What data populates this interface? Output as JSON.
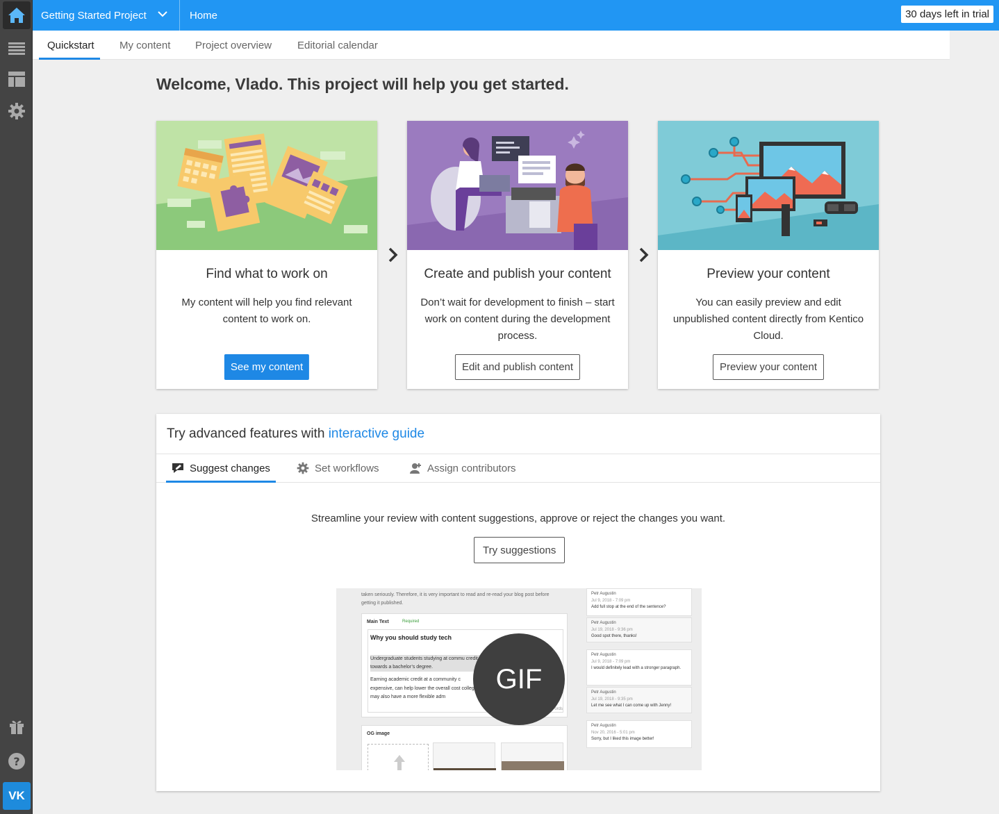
{
  "rail": {
    "items": [
      {
        "name": "home-icon"
      },
      {
        "name": "content-list-icon"
      },
      {
        "name": "layout-icon"
      },
      {
        "name": "settings-icon"
      }
    ],
    "bottom": [
      {
        "name": "gift-icon"
      },
      {
        "name": "help-icon"
      }
    ],
    "avatar_initials": "VK"
  },
  "topbar": {
    "project_name": "Getting Started Project",
    "breadcrumb": "Home",
    "trial_text": "30 days left in trial"
  },
  "tabs": [
    {
      "label": "Quickstart",
      "active": true
    },
    {
      "label": "My content",
      "active": false
    },
    {
      "label": "Project overview",
      "active": false
    },
    {
      "label": "Editorial calendar",
      "active": false
    }
  ],
  "welcome": "Welcome, Vlado. This project will help you get started.",
  "cards": [
    {
      "title": "Find what to work on",
      "description": "My content will help you find relevant content to work on.",
      "button": "See my content",
      "button_style": "primary"
    },
    {
      "title": "Create and publish your content",
      "description": "Don’t wait for development to finish – start work on content during the development process.",
      "button": "Edit and publish content",
      "button_style": "outline"
    },
    {
      "title": "Preview your content",
      "description": "You can easily preview and edit unpublished content directly from Kentico Cloud.",
      "button": "Preview your content",
      "button_style": "outline"
    }
  ],
  "guide": {
    "heading_prefix": "Try advanced features with",
    "heading_link": "interactive guide",
    "tabs": [
      {
        "label": "Suggest changes",
        "icon": "comment-edit-icon",
        "active": true
      },
      {
        "label": "Set workflows",
        "icon": "gear-icon",
        "active": false
      },
      {
        "label": "Assign contributors",
        "icon": "user-add-icon",
        "active": false
      }
    ],
    "description": "Streamline your review with content suggestions, approve or reject the changes you want.",
    "button": "Try suggestions",
    "gif_label": "GIF",
    "preview": {
      "intro": "taken seriously. Therefore, it is very important to read and re-read your blog post before getting it published.",
      "field_label": "Main Text",
      "required": "Required",
      "heading": "Why you should study tech",
      "para1": "Undergraduate students studying at commu credit towards a bachelor’s degree.",
      "para2": "Earning academic credit at a community c expensive, can help lower the overall cost colleges may also have a more flexible adm",
      "words": "ords",
      "og_label": "OG image",
      "comments": [
        {
          "author": "Petr Augustin",
          "date": "Jul 9, 2018 - 7:09 pm",
          "text": "Add full stop at the end of the sentence?"
        },
        {
          "author": "Petr Augustin",
          "date": "Jul 19, 2018 - 9:36 pm",
          "text": "Good spot there, thanks!"
        },
        {
          "author": "Petr Augustin",
          "date": "Jul 9, 2018 - 7:09 pm",
          "text": "I would definitely lead with a stronger paragraph."
        },
        {
          "author": "Petr Augustin",
          "date": "Jul 19, 2018 - 9:35 pm",
          "text": "Let me see what I can come up with Jenny!"
        },
        {
          "author": "Petr Augustin",
          "date": "Nov 20, 2016 - 5:01 pm",
          "text": "Sorry, but I liked this image better!"
        }
      ]
    }
  },
  "colors": {
    "accent": "#2196f3",
    "rail": "#444444",
    "link": "#1e88e5"
  }
}
